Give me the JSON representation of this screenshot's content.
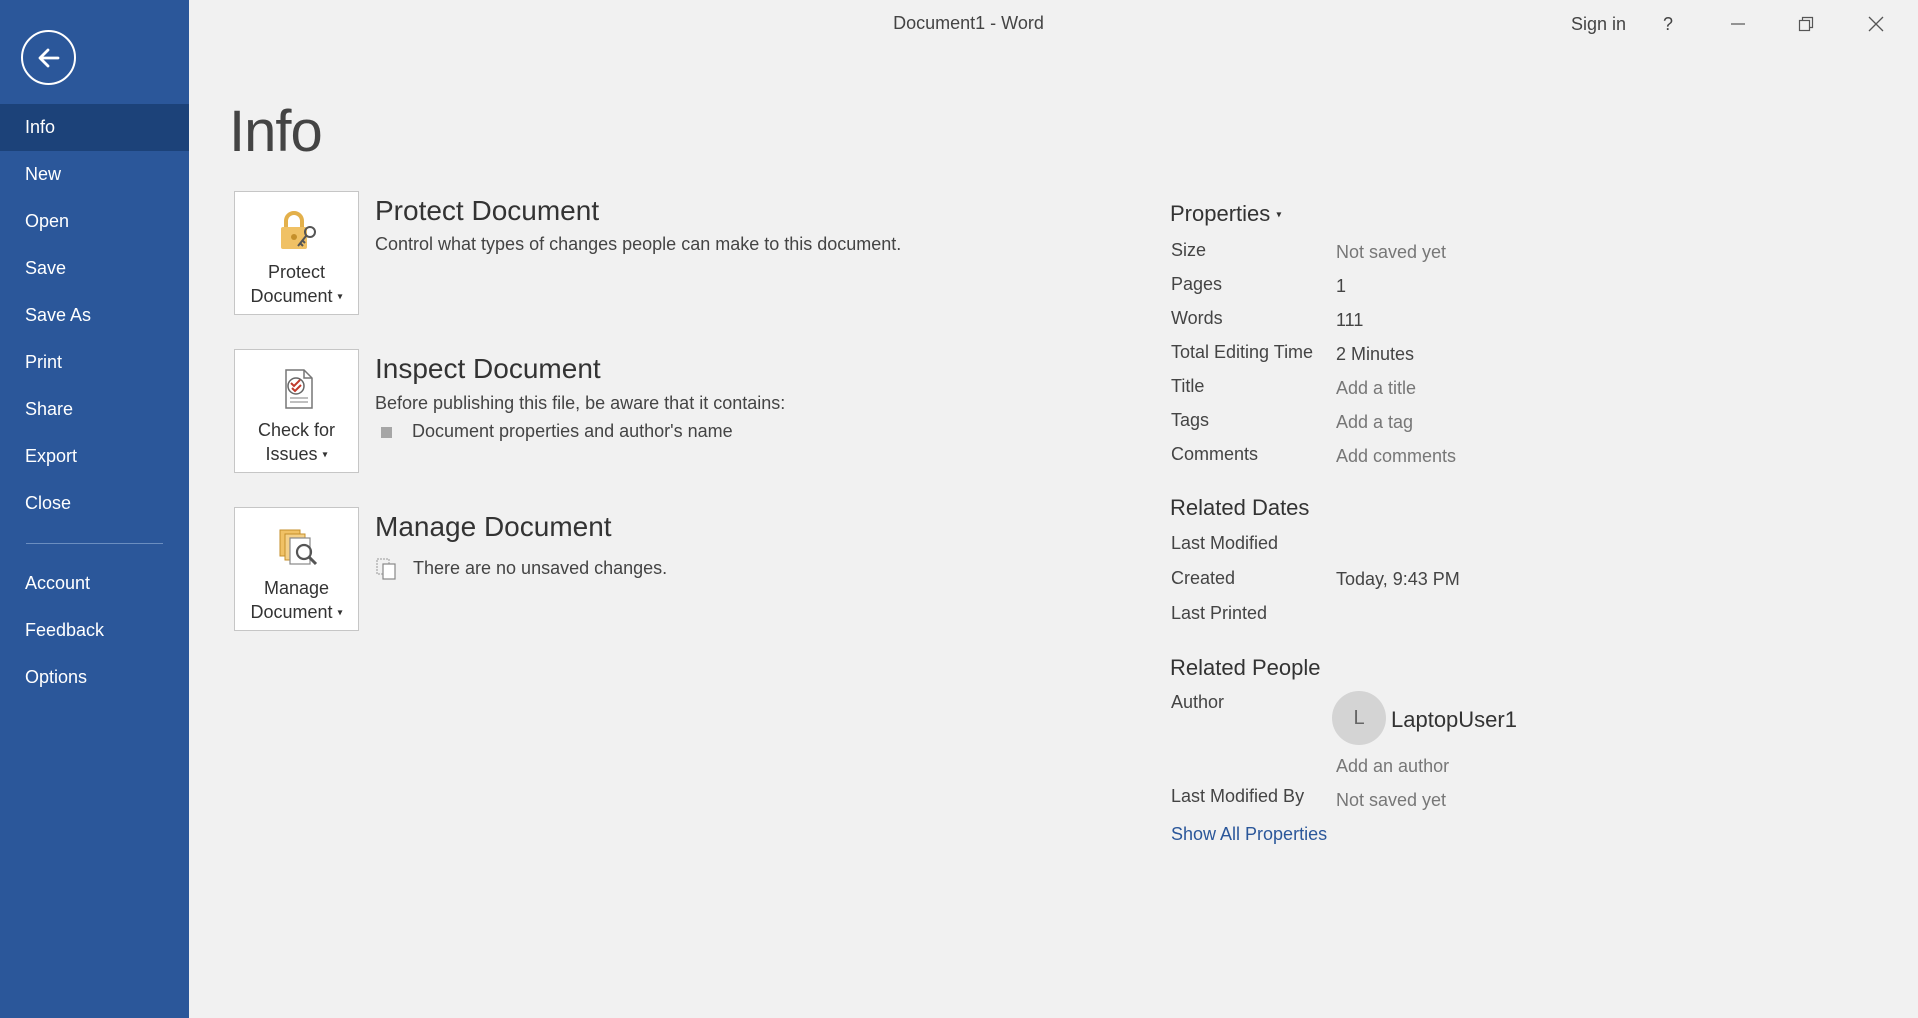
{
  "titlebar": {
    "document_title": "Document1  -  Word",
    "sign_in": "Sign in",
    "help": "?"
  },
  "sidebar": {
    "items": [
      {
        "label": "Info"
      },
      {
        "label": "New"
      },
      {
        "label": "Open"
      },
      {
        "label": "Save"
      },
      {
        "label": "Save As"
      },
      {
        "label": "Print"
      },
      {
        "label": "Share"
      },
      {
        "label": "Export"
      },
      {
        "label": "Close"
      },
      {
        "label": "Account"
      },
      {
        "label": "Feedback"
      },
      {
        "label": "Options"
      }
    ]
  },
  "main": {
    "title": "Info",
    "protect": {
      "button_line1": "Protect",
      "button_line2": "Document",
      "heading": "Protect Document",
      "description": "Control what types of changes people can make to this document."
    },
    "inspect": {
      "button_line1": "Check for",
      "button_line2": "Issues",
      "heading": "Inspect Document",
      "description": "Before publishing this file, be aware that it contains:",
      "bullet": "Document properties and author's name"
    },
    "manage": {
      "button_line1": "Manage",
      "button_line2": "Document",
      "heading": "Manage Document",
      "description": "There are no unsaved changes."
    }
  },
  "properties": {
    "heading": "Properties",
    "rows": [
      {
        "label": "Size",
        "value": "Not saved yet"
      },
      {
        "label": "Pages",
        "value": "1"
      },
      {
        "label": "Words",
        "value": "111"
      },
      {
        "label": "Total Editing Time",
        "value": "2 Minutes"
      },
      {
        "label": "Title",
        "value": "Add a title"
      },
      {
        "label": "Tags",
        "value": "Add a tag"
      },
      {
        "label": "Comments",
        "value": "Add comments"
      }
    ],
    "related_dates": {
      "heading": "Related Dates",
      "rows": [
        {
          "label": "Last Modified",
          "value": ""
        },
        {
          "label": "Created",
          "value": "Today, 9:43 PM"
        },
        {
          "label": "Last Printed",
          "value": ""
        }
      ]
    },
    "related_people": {
      "heading": "Related People",
      "author_label": "Author",
      "author_initial": "L",
      "author_name": "LaptopUser1",
      "add_author": "Add an author",
      "last_modified_by_label": "Last Modified By",
      "last_modified_by_value": "Not saved yet"
    },
    "show_all": "Show All Properties"
  },
  "colors": {
    "sidebar": "#2b579a",
    "sidebar_active": "#1c4279",
    "background": "#f1f1f1",
    "link": "#2b579a"
  }
}
